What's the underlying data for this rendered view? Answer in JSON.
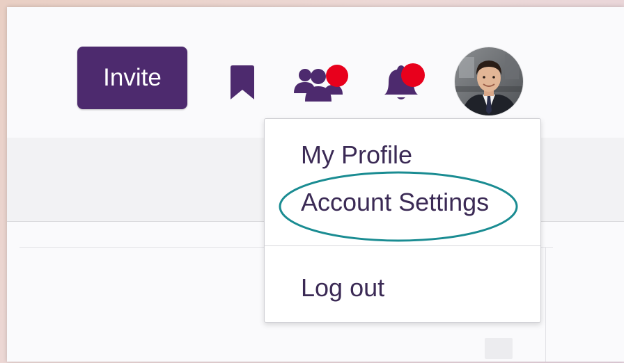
{
  "header": {
    "invite_label": "Invite",
    "icons": {
      "bookmark": "bookmark-icon",
      "people": "people-icon",
      "bell": "bell-icon"
    },
    "notification_color": "#e8001c",
    "brand_color": "#4d2a6e"
  },
  "user_menu": {
    "items": [
      {
        "label": "My Profile"
      },
      {
        "label": "Account Settings"
      },
      {
        "label": "Log out"
      }
    ],
    "highlighted_item": "Account Settings",
    "highlight_color": "#1a8c92"
  }
}
